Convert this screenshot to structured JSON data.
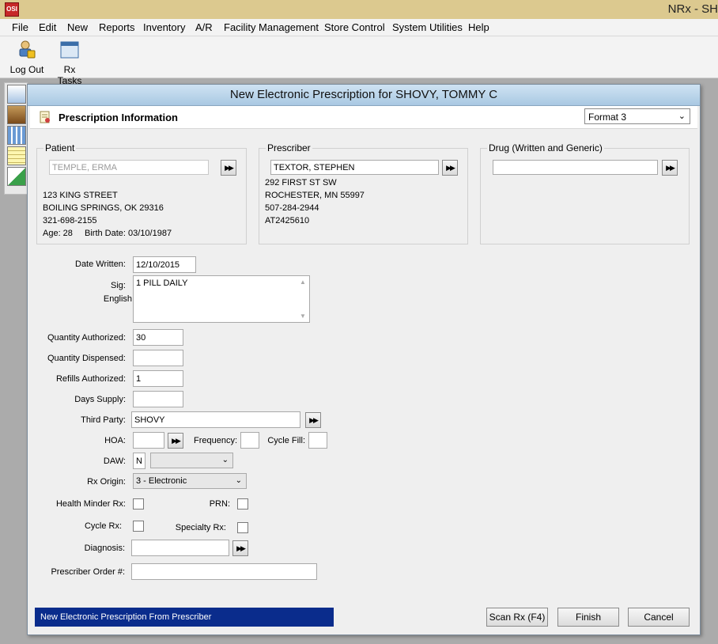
{
  "window": {
    "app_icon_text": "OSI",
    "title": "NRx - SH"
  },
  "menu": [
    "File",
    "Edit",
    "New",
    "Reports",
    "Inventory",
    "A/R",
    "Facility Management",
    "Store Control",
    "System Utilities",
    "Help"
  ],
  "toolbar": {
    "logout_label": "Log Out",
    "rx_tasks_label": "Rx Tasks"
  },
  "dialog": {
    "title": "New Electronic Prescription for SHOVY, TOMMY C",
    "section_title": "Prescription Information",
    "format": {
      "selected": "Format 3"
    },
    "patient": {
      "legend": "Patient",
      "name": "TEMPLE, ERMA",
      "address1": "123 KING STREET",
      "address2": "BOILING SPRINGS, OK 29316",
      "phone": "321-698-2155",
      "age_line": "Age: 28",
      "birth_line": "Birth Date: 03/10/1987"
    },
    "prescriber": {
      "legend": "Prescriber",
      "name": "TEXTOR, STEPHEN",
      "address1": "292 FIRST ST SW",
      "address2": "ROCHESTER, MN 55997",
      "phone": "507-284-2944",
      "id": "AT2425610"
    },
    "drug": {
      "legend": "Drug (Written and Generic)",
      "value": ""
    },
    "form": {
      "date_written_label": "Date Written:",
      "date_written": "12/10/2015",
      "sig_label": "Sig:",
      "sig_lang": "English",
      "sig_text": "1 PILL DAILY",
      "qty_auth_label": "Quantity Authorized:",
      "qty_auth": "30",
      "qty_disp_label": "Quantity Dispensed:",
      "qty_disp": "",
      "refills_label": "Refills Authorized:",
      "refills": "1",
      "days_label": "Days Supply:",
      "days": "",
      "third_party_label": "Third Party:",
      "third_party": "SHOVY",
      "hoa_label": "HOA:",
      "hoa": "",
      "frequency_label": "Frequency:",
      "frequency": "",
      "cycle_fill_label": "Cycle Fill:",
      "cycle_fill": "",
      "daw_label": "DAW:",
      "daw": "N",
      "daw_option": "",
      "rx_origin_label": "Rx Origin:",
      "rx_origin": "3 - Electronic",
      "health_minder_label": "Health Minder Rx:",
      "prn_label": "PRN:",
      "cycle_rx_label": "Cycle Rx:",
      "specialty_label": "Specialty Rx:",
      "diagnosis_label": "Diagnosis:",
      "diagnosis": "",
      "order_label": "Prescriber Order #:",
      "order": ""
    },
    "status_text": "New Electronic Prescription From Prescriber",
    "buttons": {
      "scan": "Scan Rx (F4)",
      "finish": "Finish",
      "cancel": "Cancel"
    }
  },
  "icons": {
    "logout": "lock-user-icon",
    "rx_tasks": "window-icon",
    "fast_forward": "fast-forward-icon",
    "dropdown": "chevron-down-icon"
  },
  "colors": {
    "titlebar": "#dcc98f",
    "dialog_title": "#b8d4ea",
    "status_bar": "#0a2c8c"
  }
}
